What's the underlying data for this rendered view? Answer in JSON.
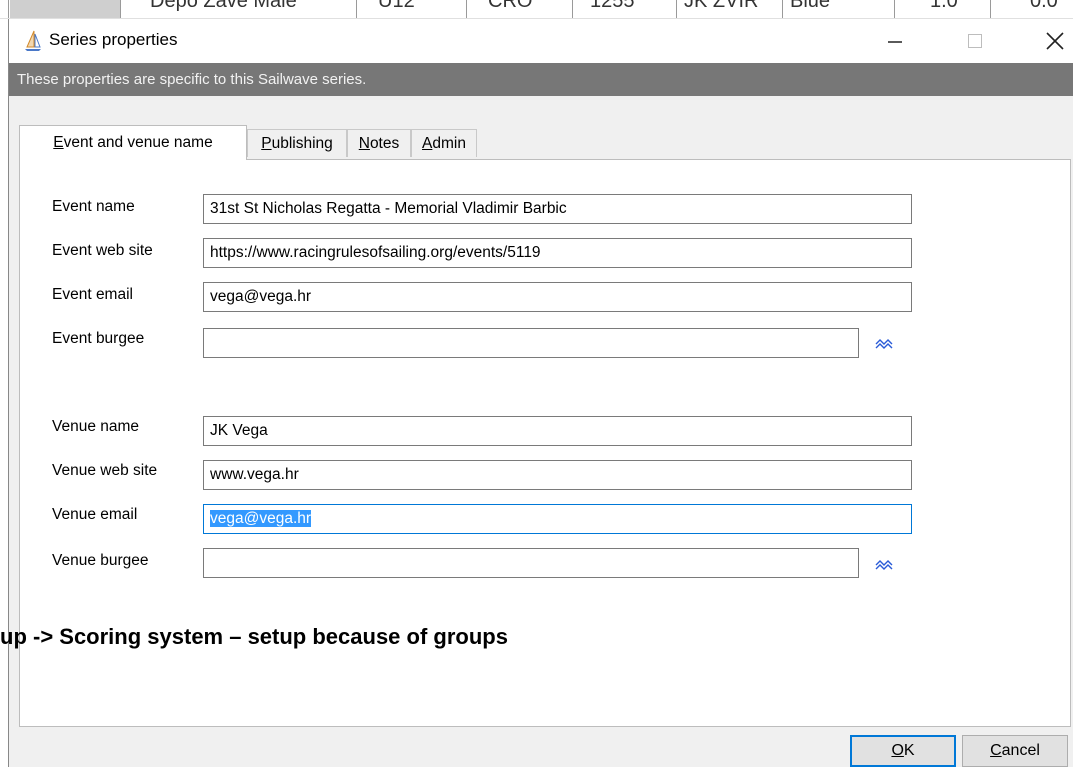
{
  "background_table": {
    "cells": [
      "Depo Zave Male",
      "U12",
      "CRO",
      "1255",
      "JK ZVIR",
      "Blue",
      "1.0",
      "0.0"
    ]
  },
  "window": {
    "title": "Series properties",
    "controls": {
      "minimize": "minimize-icon",
      "maximize": "maximize-icon",
      "close": "close-icon"
    }
  },
  "header": {
    "text": "These properties are specific to this Sailwave series."
  },
  "tabs": [
    {
      "first": "E",
      "rest": "vent and venue name",
      "active": true
    },
    {
      "first": "P",
      "rest": "ublishing",
      "active": false
    },
    {
      "first": "N",
      "rest": "otes",
      "active": false
    },
    {
      "first": "A",
      "rest": "dmin",
      "active": false
    }
  ],
  "fields": {
    "event_name": {
      "label": "Event name",
      "value": "31st St Nicholas Regatta - Memorial Vladimir Barbic"
    },
    "event_web_site": {
      "label": "Event web site",
      "value": "https://www.racingrulesofsailing.org/events/5119"
    },
    "event_email": {
      "label": "Event email",
      "value": "vega@vega.hr"
    },
    "event_burgee": {
      "label": "Event burgee",
      "value": ""
    },
    "venue_name": {
      "label": "Venue name",
      "value": "JK Vega"
    },
    "venue_web_site": {
      "label": "Venue web site",
      "value": "www.vega.hr"
    },
    "venue_email": {
      "label": "Venue email",
      "value": "vega@vega.hr"
    },
    "venue_burgee": {
      "label": "Venue burgee",
      "value": ""
    }
  },
  "overlay_caption": "up -> Scoring system – setup because of groups",
  "buttons": {
    "ok": {
      "first": "O",
      "rest": "K"
    },
    "cancel": {
      "first": "C",
      "rest": "ancel"
    }
  },
  "colors": {
    "header_band": "#777777",
    "selection": "#3399ff",
    "focus_border": "#0078d7",
    "burgee_icon": "#2a5bd7"
  },
  "icons": {
    "app": "sailboat-icon",
    "burgee": "wave-chevrons-icon"
  }
}
